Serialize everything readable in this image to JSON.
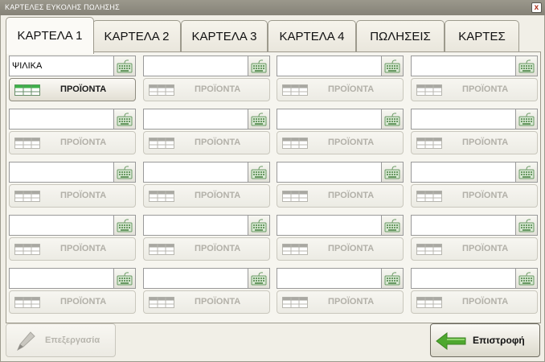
{
  "window": {
    "title": "ΚΑΡΤΕΛΕΣ ΕΥΚΟΛΗΣ ΠΩΛΗΣΗΣ",
    "close_label": "x"
  },
  "tabs": [
    {
      "label": "ΚΑΡΤΕΛΑ 1",
      "active": true
    },
    {
      "label": "ΚΑΡΤΕΛΑ 2",
      "active": false
    },
    {
      "label": "ΚΑΡΤΕΛΑ 3",
      "active": false
    },
    {
      "label": "ΚΑΡΤΕΛΑ 4",
      "active": false
    },
    {
      "label": "ΠΩΛΗΣΕΙΣ",
      "active": false
    },
    {
      "label": "ΚΑΡΤΕΣ",
      "active": false
    }
  ],
  "grid": {
    "cells": [
      {
        "value": "ΨΙΛΙΚΑ",
        "button": "ΠΡΟΪΟΝΤΑ",
        "enabled": true
      },
      {
        "value": "",
        "button": "ΠΡΟΪΟΝΤΑ",
        "enabled": false
      },
      {
        "value": "",
        "button": "ΠΡΟΪΟΝΤΑ",
        "enabled": false
      },
      {
        "value": "",
        "button": "ΠΡΟΪΟΝΤΑ",
        "enabled": false
      },
      {
        "value": "",
        "button": "ΠΡΟΪΟΝΤΑ",
        "enabled": false
      },
      {
        "value": "",
        "button": "ΠΡΟΪΟΝΤΑ",
        "enabled": false
      },
      {
        "value": "",
        "button": "ΠΡΟΪΟΝΤΑ",
        "enabled": false
      },
      {
        "value": "",
        "button": "ΠΡΟΪΟΝΤΑ",
        "enabled": false
      },
      {
        "value": "",
        "button": "ΠΡΟΪΟΝΤΑ",
        "enabled": false
      },
      {
        "value": "",
        "button": "ΠΡΟΪΟΝΤΑ",
        "enabled": false
      },
      {
        "value": "",
        "button": "ΠΡΟΪΟΝΤΑ",
        "enabled": false
      },
      {
        "value": "",
        "button": "ΠΡΟΪΟΝΤΑ",
        "enabled": false
      },
      {
        "value": "",
        "button": "ΠΡΟΪΟΝΤΑ",
        "enabled": false
      },
      {
        "value": "",
        "button": "ΠΡΟΪΟΝΤΑ",
        "enabled": false
      },
      {
        "value": "",
        "button": "ΠΡΟΪΟΝΤΑ",
        "enabled": false
      },
      {
        "value": "",
        "button": "ΠΡΟΪΟΝΤΑ",
        "enabled": false
      },
      {
        "value": "",
        "button": "ΠΡΟΪΟΝΤΑ",
        "enabled": false
      },
      {
        "value": "",
        "button": "ΠΡΟΪΟΝΤΑ",
        "enabled": false
      },
      {
        "value": "",
        "button": "ΠΡΟΪΟΝΤΑ",
        "enabled": false
      },
      {
        "value": "",
        "button": "ΠΡΟΪΟΝΤΑ",
        "enabled": false
      }
    ]
  },
  "footer": {
    "edit_label": "Επεξεργασία",
    "edit_enabled": false,
    "back_label": "Επιστροφή"
  },
  "colors": {
    "grid_icon_active": "#3fb04a",
    "grid_icon_disabled": "#a9a8a2",
    "keyboard_icon": "#6a9a64",
    "back_arrow": "#4ea82f"
  },
  "icons": {
    "keyboard": "keyboard-icon",
    "grid": "grid-icon",
    "edit": "pen-icon",
    "back": "arrow-left-icon"
  }
}
